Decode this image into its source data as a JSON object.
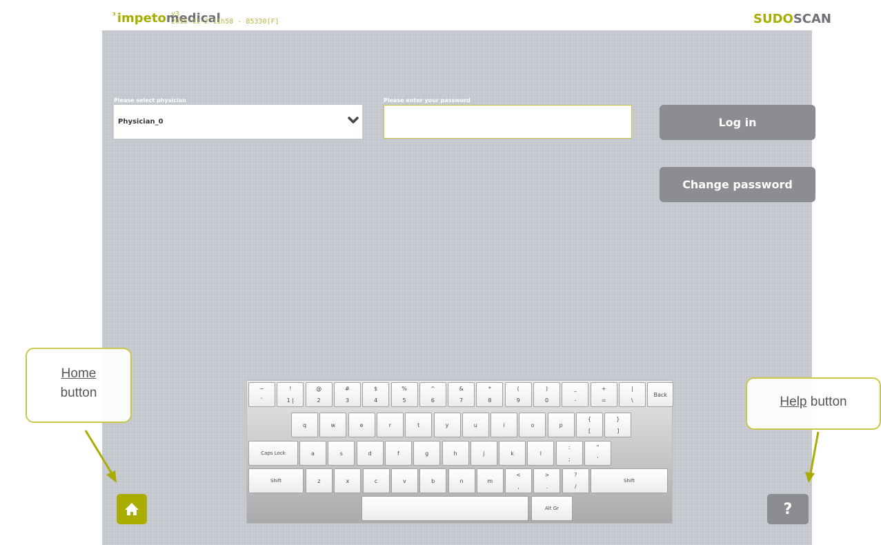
{
  "header": {
    "brand_prefix": "impeto",
    "brand_suffix": "medical",
    "brand_mark": "³",
    "version_line1": "v3",
    "version_line2": "2015-11-2 11h58 - 85330[F]",
    "product_prefix": "SUDO",
    "product_suffix": "SCAN"
  },
  "login": {
    "physician_label": "Please select physician",
    "physician_value": "Physician_0",
    "password_label": "Please enter your password",
    "password_value": "",
    "login_label": "Log in",
    "change_password_label": "Change password"
  },
  "keyboard": {
    "row1": [
      {
        "top": "~",
        "bottom": "`"
      },
      {
        "top": "!",
        "bottom": "1 |"
      },
      {
        "top": "@",
        "bottom": "2"
      },
      {
        "top": "#",
        "bottom": "3"
      },
      {
        "top": "$",
        "bottom": "4"
      },
      {
        "top": "%",
        "bottom": "5"
      },
      {
        "top": "^",
        "bottom": "6"
      },
      {
        "top": "&",
        "bottom": "7"
      },
      {
        "top": "*",
        "bottom": "8"
      },
      {
        "top": "(",
        "bottom": "9"
      },
      {
        "top": ")",
        "bottom": "0"
      },
      {
        "top": "_",
        "bottom": "-"
      },
      {
        "top": "+",
        "bottom": "="
      },
      {
        "top": "|",
        "bottom": "\\"
      }
    ],
    "back_label": "Back",
    "row2": [
      "q",
      "w",
      "e",
      "r",
      "t",
      "y",
      "u",
      "i",
      "o",
      "p"
    ],
    "row2_extra": [
      {
        "top": "{",
        "bottom": "["
      },
      {
        "top": "}",
        "bottom": "]"
      }
    ],
    "caps_label": "Caps Lock",
    "row3": [
      "a",
      "s",
      "d",
      "f",
      "g",
      "h",
      "j",
      "k",
      "l"
    ],
    "row3_extra": [
      {
        "top": ":",
        "bottom": ";"
      },
      {
        "top": "\"",
        "bottom": "'"
      }
    ],
    "shift_label": "Shift",
    "row4": [
      "z",
      "x",
      "c",
      "v",
      "b",
      "n",
      "m"
    ],
    "row4_extra": [
      {
        "top": "<",
        "bottom": ","
      },
      {
        "top": ">",
        "bottom": "."
      },
      {
        "top": "?",
        "bottom": "/"
      }
    ],
    "altgr_label": "Alt Gr"
  },
  "buttons": {
    "home_icon": "home-icon",
    "help_label": "?"
  },
  "callouts": {
    "home_title": "Home",
    "home_text": "button",
    "help_title": "Help",
    "help_text": " button"
  },
  "colors": {
    "accent": "#a8ad00",
    "button_gray": "#8b8d90",
    "screen_bg": "#c3c6cc"
  }
}
